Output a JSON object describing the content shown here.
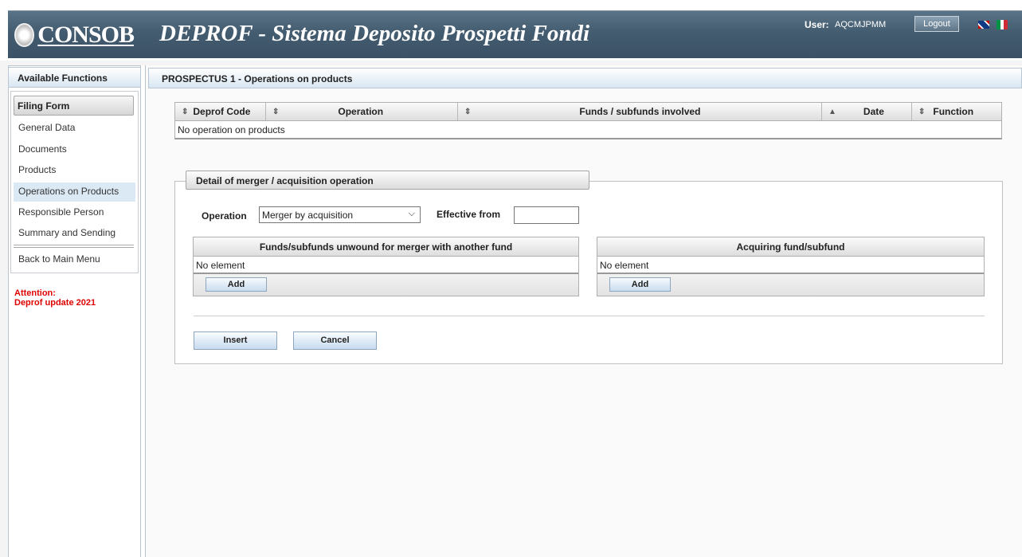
{
  "header": {
    "logo_text": "CONSOB",
    "app_title": "DEPROF - Sistema Deposito Prospetti Fondi",
    "user_label": "User:",
    "user_value": "AQCMJPMM",
    "logout_label": "Logout"
  },
  "sidebar": {
    "title": "Available Functions",
    "section_label": "Filing Form",
    "items": [
      {
        "label": "General Data"
      },
      {
        "label": "Documents"
      },
      {
        "label": "Products"
      },
      {
        "label": "Operations on Products",
        "active": true
      },
      {
        "label": "Responsible Person"
      },
      {
        "label": "Summary and Sending"
      }
    ],
    "back_label": "Back to Main Menu",
    "attention_line1": "Attention:",
    "attention_line2": "Deprof update 2021"
  },
  "main": {
    "title": "PROSPECTUS 1 - Operations on products",
    "operations_table": {
      "columns": [
        {
          "label": "Deprof Code",
          "sort_icon": "⇕"
        },
        {
          "label": "Operation",
          "sort_icon": "⇕"
        },
        {
          "label": "Funds / subfunds involved",
          "sort_icon": "⇕"
        },
        {
          "label": "Date",
          "sort_icon": "▲"
        },
        {
          "label": "Function",
          "sort_icon": "⇕"
        }
      ],
      "empty_text": "No operation on products"
    },
    "detail": {
      "tab_label": "Detail of merger / acquisition operation",
      "operation_label": "Operation",
      "operation_value": "Merger by acquisition",
      "effective_from_label": "Effective from",
      "effective_from_value": "",
      "left_table": {
        "header": "Funds/subfunds unwound for merger with another fund",
        "empty_text": "No element",
        "add_label": "Add"
      },
      "right_table": {
        "header": "Acquiring fund/subfund",
        "empty_text": "No element",
        "add_label": "Add"
      },
      "insert_label": "Insert",
      "cancel_label": "Cancel"
    }
  }
}
